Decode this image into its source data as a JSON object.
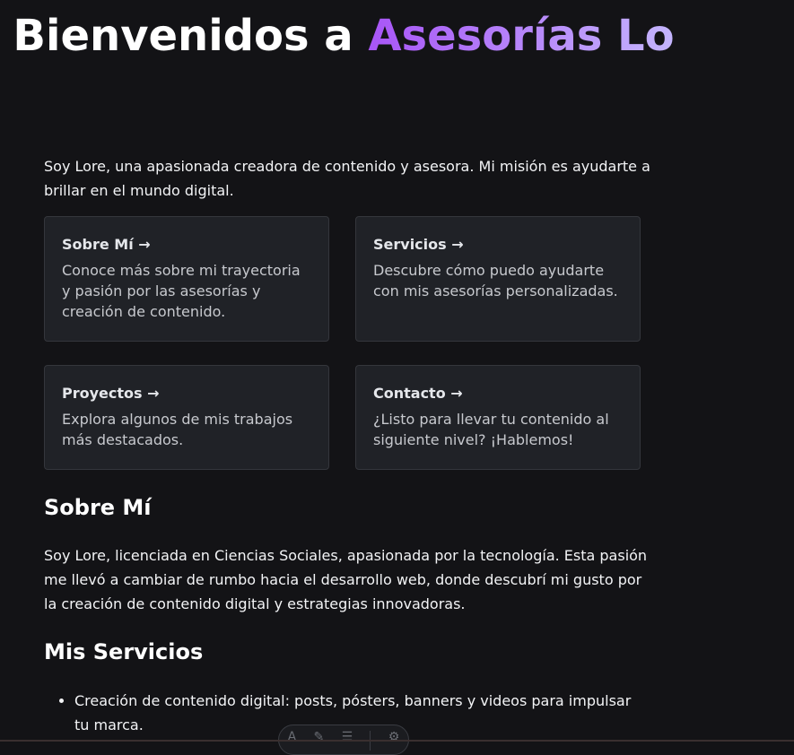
{
  "hero": {
    "title_prefix": "Bienvenidos a ",
    "title_accent": "Asesorías Lo"
  },
  "intro": "Soy Lore, una apasionada creadora de contenido y asesora. Mi misión es ayudarte a brillar en el mundo digital.",
  "cards": [
    {
      "title": "Sobre Mí →",
      "description": "Conoce más sobre mi trayectoria y pasión por las asesorías y creación de contenido."
    },
    {
      "title": "Servicios →",
      "description": "Descubre cómo puedo ayudarte con mis asesorías personalizadas."
    },
    {
      "title": "Proyectos →",
      "description": "Explora algunos de mis trabajos más destacados."
    },
    {
      "title": "Contacto →",
      "description": "¿Listo para llevar tu contenido al siguiente nivel? ¡Hablemos!"
    }
  ],
  "about": {
    "heading": "Sobre Mí",
    "text": "Soy Lore, licenciada en Ciencias Sociales, apasionada por la tecnología. Esta pasión me llevó a cambiar de rumbo hacia el desarrollo web, donde descubrí mi gusto por la creación de contenido digital y estrategias innovadoras."
  },
  "services": {
    "heading": "Mis Servicios",
    "items": [
      "Creación de contenido digital: posts, pósters, banners y videos para impulsar tu marca."
    ]
  },
  "toolbar": {
    "icons": [
      "text-icon",
      "brush-icon",
      "menu-icon",
      "gear-icon"
    ]
  },
  "colors": {
    "background": "#131316",
    "card_background": "#202227",
    "accent_start": "#a855f7",
    "accent_end": "#c4b5fd"
  }
}
